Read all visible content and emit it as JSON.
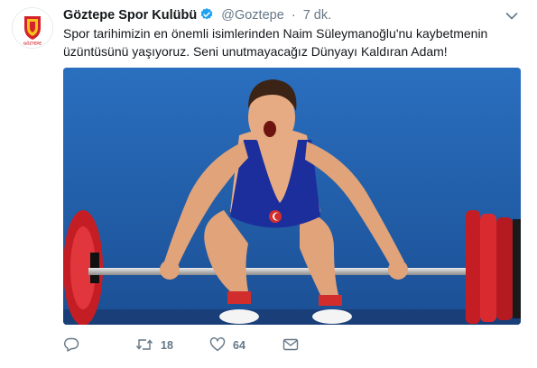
{
  "tweet": {
    "display_name": "Göztepe Spor Kulübü",
    "handle": "@Goztepe",
    "separator": "·",
    "time": "7 dk.",
    "text": "Spor tarihimizin en önemli isimlerinden Naim Süleymanoğlu'nu kaybetmenin üzüntüsünü yaşıyoruz. Seni unutmayacağız Dünyayı Kaldıran Adam!",
    "avatar_text": "GÖZTEPE"
  },
  "actions": {
    "reply_count": "",
    "retweet_count": "18",
    "like_count": "64"
  },
  "colors": {
    "text": "#14171a",
    "secondary": "#657786",
    "verified": "#1da1f2",
    "logo_red": "#d3242b",
    "logo_yellow": "#f7c21c"
  }
}
